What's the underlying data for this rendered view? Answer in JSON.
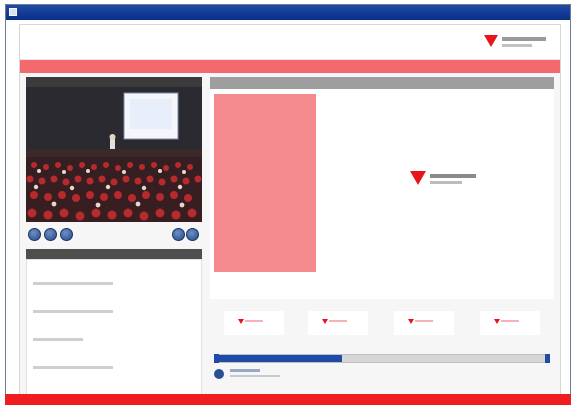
{
  "window": {
    "title": ""
  },
  "header": {
    "app_title": "",
    "logo": ""
  },
  "redbar": {
    "left_text": "",
    "right_link": ""
  },
  "video": {
    "title": "",
    "time": "",
    "controls": [
      "",
      "",
      ""
    ],
    "nav": [
      "",
      ""
    ]
  },
  "info_tabs": [
    "",
    "",
    ""
  ],
  "info": {
    "fields": [
      {
        "label": "",
        "value": ""
      },
      {
        "label": "",
        "value": ""
      },
      {
        "label": "",
        "value": ""
      },
      {
        "label": "",
        "value": ""
      }
    ]
  },
  "slides": {
    "title": "",
    "thumbnail_count": 4,
    "progress": 0.38
  },
  "colors": {
    "brand_red": "#e8141c",
    "pink": "#f58a8e",
    "navy": "#1f4ba8"
  }
}
